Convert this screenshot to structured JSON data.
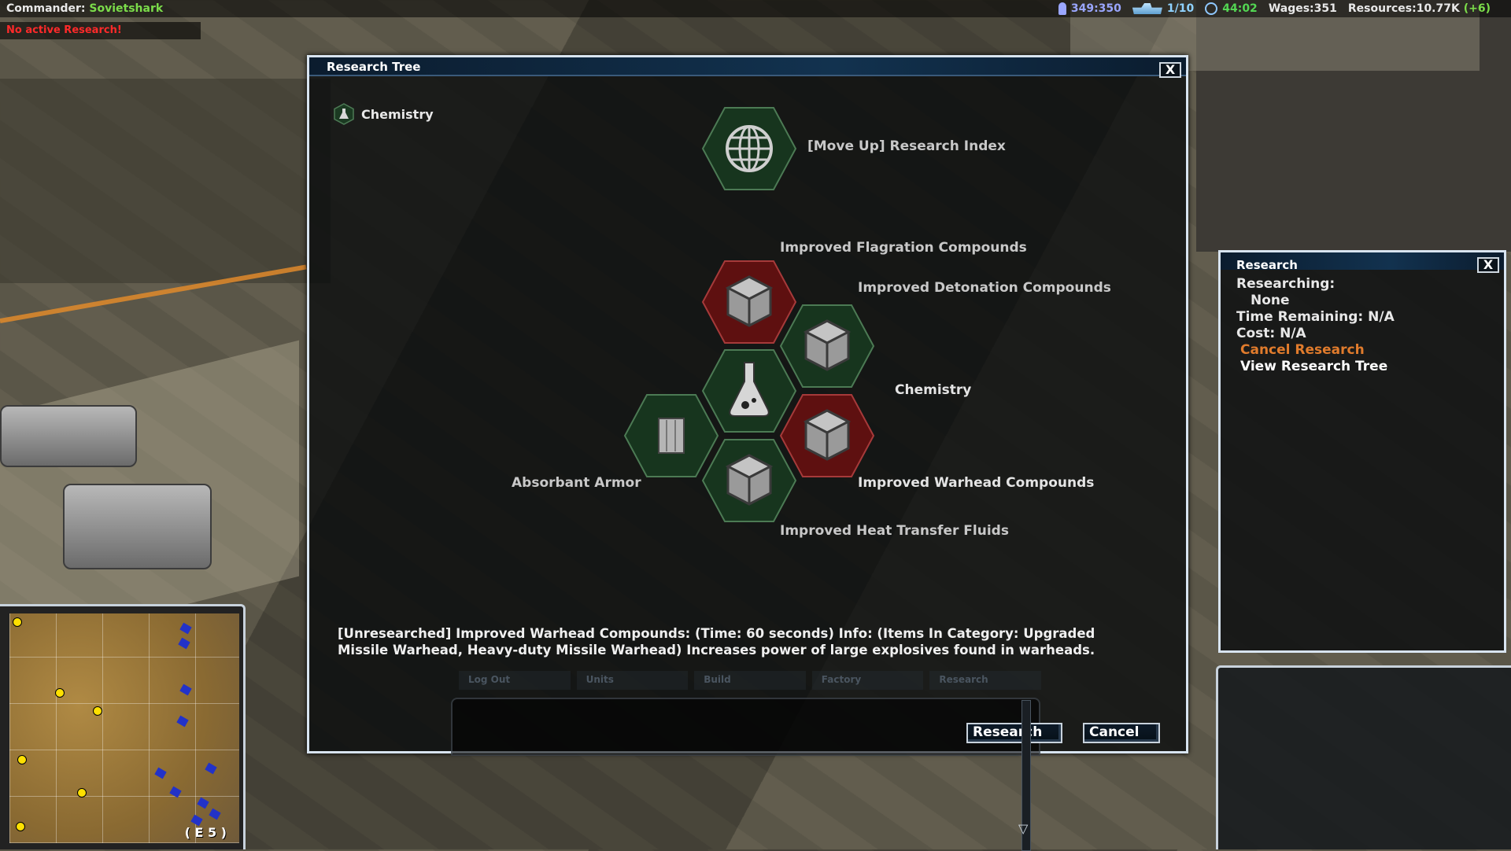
{
  "hud": {
    "commander_label": "Commander:",
    "commander_name": "Sovietshark",
    "research_status": "No active Research!",
    "population": "349:350",
    "vehicles": "1/10",
    "time": "44:02",
    "wages": "Wages:351",
    "resources": "Resources:10.77K",
    "resources_income": "(+6)"
  },
  "tree": {
    "title": "Research Tree",
    "close": "X",
    "breadcrumb": "Chemistry",
    "nodes": {
      "move_up": "[Move Up] Research Index",
      "flagration": "Improved Flagration Compounds",
      "detonation": "Improved Detonation Compounds",
      "chemistry": "Chemistry",
      "absorbant": "Absorbant Armor",
      "warhead": "Improved Warhead Compounds",
      "heat": "Improved Heat Transfer Fluids"
    },
    "info_line1": "[Unresearched] Improved Warhead Compounds: (Time: 60 seconds) Info: (Items In Category: Upgraded",
    "info_line2": "Missile Warhead, Heavy-duty Missile Warhead) Increases power of large explosives found in warheads.",
    "research_button": "Research",
    "cancel_button": "Cancel"
  },
  "ghost_tabs": [
    "Log Out",
    "Units",
    "Build",
    "Factory",
    "Research"
  ],
  "side": {
    "title": "Research",
    "close": "X",
    "researching_label": "Researching:",
    "researching_value": "None",
    "time_remaining": "Time Remaining: N/A",
    "cost": "Cost: N/A",
    "cancel_research": "Cancel Research",
    "view_tree": "View Research Tree"
  },
  "minimap": {
    "grid_ref": "( E 5 )"
  },
  "colors": {
    "hex_green": "#1f4a2a",
    "hex_red": "#7a1414",
    "accent_orange": "#e07b2c",
    "alert_red": "#ff2a2a"
  }
}
